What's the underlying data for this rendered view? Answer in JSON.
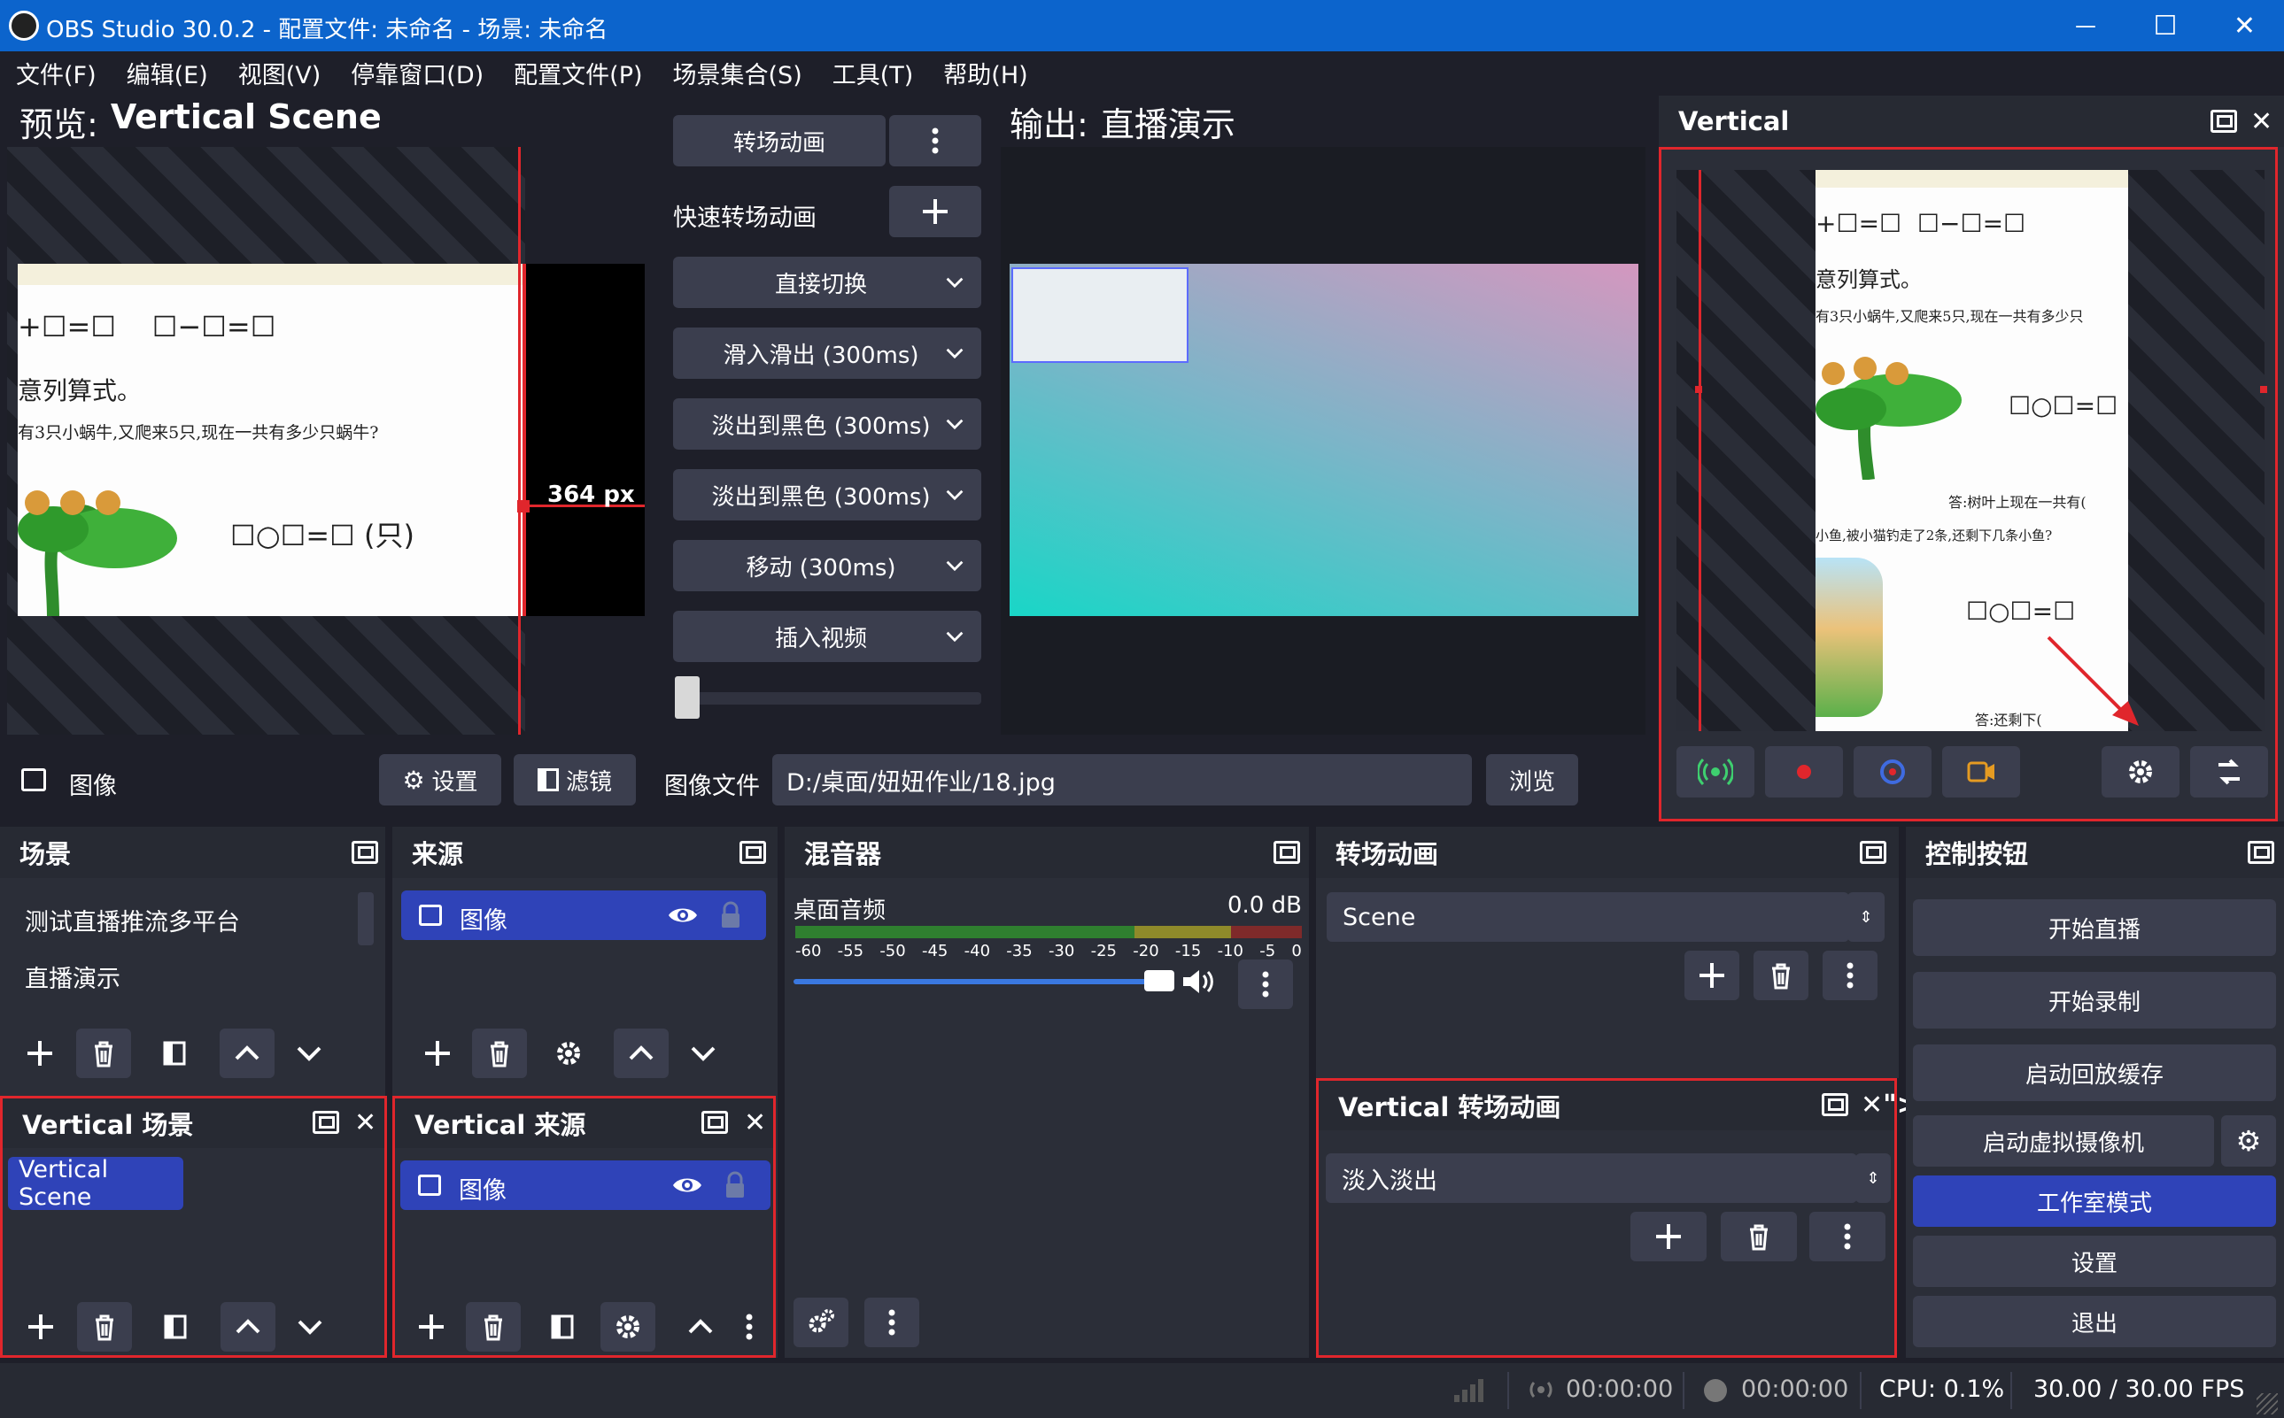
{
  "window": {
    "title": "OBS Studio 30.0.2 - 配置文件: 未命名 - 场景: 未命名",
    "controls": {
      "minimize": "—",
      "maximize": "☐",
      "close": "✕"
    }
  },
  "menu": [
    "文件(F)",
    "编辑(E)",
    "视图(V)",
    "停靠窗口(D)",
    "配置文件(P)",
    "场景集合(S)",
    "工具(T)",
    "帮助(H)"
  ],
  "preview": {
    "label": "预览:",
    "scene": "Vertical Scene",
    "measure": "364 px",
    "img_top": "+☐=☐    ☐−☐=☐",
    "img_line2": "意列算式。",
    "img_line3": "有3只小蜗牛,又爬来5只,现在一共有多少只蜗牛?",
    "img_eq": "☐○☐=☐ (只)"
  },
  "transitions_mid": {
    "transition_button": "转场动画",
    "quick_label": "快速转场动画",
    "items": [
      "直接切换",
      "滑入滑出 (300ms)",
      "淡出到黑色 (300ms)",
      "淡出到黑色 (300ms)",
      "移动 (300ms)",
      "插入视频"
    ],
    "slider_value": 0
  },
  "output": {
    "label": "输出:",
    "scene": "直播演示"
  },
  "vertical_dock": {
    "title": "Vertical",
    "img_top": "+☐=☐  ☐−☐=☐",
    "img_line2": "意列算式。",
    "img_line3": "有3只小蜗牛,又爬来5只,现在一共有多少只",
    "img_eq": "☐○☐=☐",
    "img_ans1": "答:树叶上现在一共有(",
    "img_line4": "小鱼,被小猫钓走了2条,还剩下几条小鱼?",
    "img_eq2": "☐○☐=☐",
    "img_ans2": "答:还剩下(",
    "colors": {
      "stream": "#3ecf6f",
      "record": "#e0262c",
      "replay": "#3f6be0",
      "virtualcam": "#e59b22"
    }
  },
  "source_toolbar": {
    "source_name": "图像",
    "settings": "设置",
    "filters": "滤镜",
    "file_label": "图像文件",
    "file_path": "D:/桌面/妞妞作业/18.jpg",
    "browse": "浏览"
  },
  "scenes": {
    "title": "场景",
    "items": [
      "测试直播推流多平台",
      "直播演示"
    ]
  },
  "sources": {
    "title": "来源",
    "items": [
      "图像"
    ]
  },
  "mixer": {
    "title": "混音器",
    "channel": "桌面音频",
    "level": "0.0 dB",
    "ticks": [
      "-60",
      "-55",
      "-50",
      "-45",
      "-40",
      "-35",
      "-30",
      "-25",
      "-20",
      "-15",
      "-10",
      "-5",
      "0"
    ],
    "volume": 1.0
  },
  "transitions_dock": {
    "title": "转场动画",
    "value": "Scene"
  },
  "controls": {
    "title": "控制按钮",
    "start_stream": "开始直播",
    "start_record": "开始录制",
    "replay_buffer": "启动回放缓存",
    "virtual_cam": "启动虚拟摄像机",
    "studio_mode": "工作室模式",
    "settings": "设置",
    "exit": "退出",
    "active_color": "#2f43b8"
  },
  "vertical_scenes": {
    "title": "Vertical 场景",
    "items": [
      "Vertical Scene"
    ]
  },
  "vertical_sources": {
    "title": "Vertical 来源",
    "items": [
      "图像"
    ]
  },
  "vertical_transitions": {
    "title": "Vertical 转场动画",
    "value": "淡入淡出"
  },
  "status": {
    "stream_time": "00:00:00",
    "record_time": "00:00:00",
    "cpu": "CPU: 0.1%",
    "fps": "30.00 / 30.00 FPS"
  }
}
